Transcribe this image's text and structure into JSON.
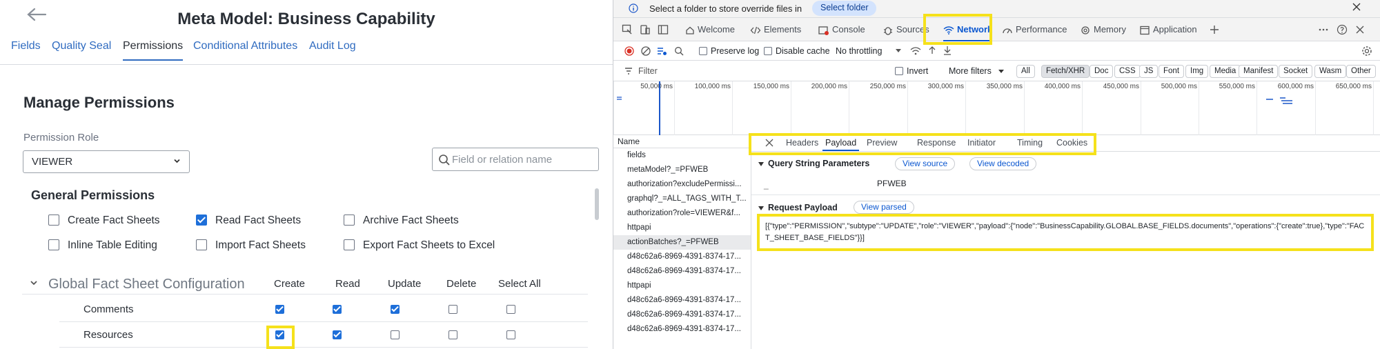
{
  "app": {
    "title": "Meta Model: Business Capability",
    "tabs": [
      "Fields",
      "Quality Seal",
      "Permissions",
      "Conditional Attributes",
      "Audit Log"
    ],
    "active_tab": "Permissions",
    "section_title": "Manage Permissions",
    "role_label": "Permission Role",
    "role_value": "VIEWER",
    "search_placeholder": "Field or relation name",
    "general_title": "General Permissions",
    "general_perms": [
      {
        "label": "Create Fact Sheets",
        "checked": false
      },
      {
        "label": "Read Fact Sheets",
        "checked": true
      },
      {
        "label": "Archive Fact Sheets",
        "checked": false
      },
      {
        "label": "Inline Table Editing",
        "checked": false
      },
      {
        "label": "Import Fact Sheets",
        "checked": false
      },
      {
        "label": "Export Fact Sheets to Excel",
        "checked": false
      }
    ],
    "gfs_title": "Global Fact Sheet Configuration",
    "columns": [
      "Create",
      "Read",
      "Update",
      "Delete",
      "Select All"
    ],
    "rows": [
      {
        "name": "Comments",
        "values": [
          true,
          true,
          true,
          false,
          false
        ]
      },
      {
        "name": "Resources",
        "values": [
          true,
          true,
          false,
          false,
          false
        ]
      }
    ]
  },
  "devtools": {
    "info_message": "Select a folder to store override files in",
    "info_button": "Select folder",
    "tabs": [
      "Welcome",
      "Elements",
      "Console",
      "Sources",
      "Network",
      "Performance",
      "Memory",
      "Application"
    ],
    "active_tab": "Network",
    "toolbar": {
      "preserve_log": "Preserve log",
      "disable_cache": "Disable cache",
      "throttling": "No throttling"
    },
    "filter": {
      "placeholder": "Filter",
      "invert": "Invert",
      "more_filters": "More filters",
      "types": [
        "All",
        "Fetch/XHR",
        "Doc",
        "CSS",
        "JS",
        "Font",
        "Img",
        "Media",
        "Manifest",
        "Socket",
        "Wasm",
        "Other"
      ],
      "active_type": "Fetch/XHR"
    },
    "timeline_ticks": [
      "50,000 ms",
      "100,000 ms",
      "150,000 ms",
      "200,000 ms",
      "250,000 ms",
      "300,000 ms",
      "350,000 ms",
      "400,000 ms",
      "450,000 ms",
      "500,000 ms",
      "550,000 ms",
      "600,000 ms",
      "650,000 ms"
    ],
    "name_header": "Name",
    "requests": [
      "fields",
      "metaModel?_=PFWEB",
      "authorization?excludePermissi...",
      "graphql?_=ALL_TAGS_WITH_T...",
      "authorization?role=VIEWER&f...",
      "httpapi",
      "actionBatches?_=PFWEB",
      "d48c62a6-8969-4391-8374-17...",
      "d48c62a6-8969-4391-8374-17...",
      "httpapi",
      "d48c62a6-8969-4391-8374-17...",
      "d48c62a6-8969-4391-8374-17...",
      "d48c62a6-8969-4391-8374-17..."
    ],
    "selected_request": "actionBatches?_=PFWEB",
    "detail_tabs": [
      "Headers",
      "Payload",
      "Preview",
      "Response",
      "Initiator",
      "Timing",
      "Cookies"
    ],
    "active_detail_tab": "Payload",
    "query_title": "Query String Parameters",
    "view_source": "View source",
    "view_decoded": "View decoded",
    "query_key": "_",
    "query_value": "PFWEB",
    "payload_title": "Request Payload",
    "view_parsed": "View parsed",
    "payload": "[{\"type\":\"PERMISSION\",\"subtype\":\"UPDATE\",\"role\":\"VIEWER\",\"payload\":{\"node\":\"BusinessCapability.GLOBAL.BASE_FIELDS.documents\",\"operations\":{\"create\":true},\"type\":\"FACT_SHEET_BASE_FIELDS\"}}]"
  },
  "colors": {
    "highlight": "#f5e11b",
    "accent": "#1e6fd9",
    "devtools_blue": "#0b57d0"
  }
}
